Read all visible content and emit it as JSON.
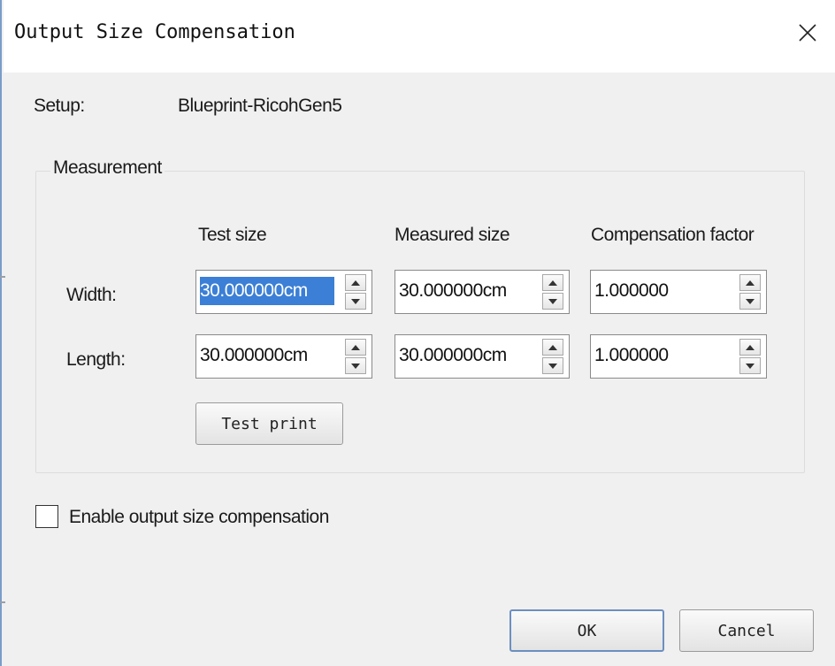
{
  "window": {
    "title": "Output Size Compensation"
  },
  "setup": {
    "label": "Setup:",
    "value": "Blueprint-RicohGen5"
  },
  "measurement": {
    "group_title": "Measurement",
    "columns": {
      "test_size": "Test size",
      "measured_size": "Measured size",
      "compensation_factor": "Compensation factor"
    },
    "rows": {
      "width": {
        "label": "Width:",
        "test_size": "30.000000cm",
        "measured_size": "30.000000cm",
        "compensation_factor": "1.000000"
      },
      "length": {
        "label": "Length:",
        "test_size": "30.000000cm",
        "measured_size": "30.000000cm",
        "compensation_factor": "1.000000"
      }
    },
    "test_print_label": "Test print"
  },
  "enable_compensation": {
    "label": "Enable output size compensation",
    "checked": false
  },
  "footer": {
    "ok_label": "OK",
    "cancel_label": "Cancel"
  },
  "icons": {
    "close": "close-icon",
    "spin_up": "arrow-up-icon",
    "spin_down": "arrow-down-icon"
  }
}
